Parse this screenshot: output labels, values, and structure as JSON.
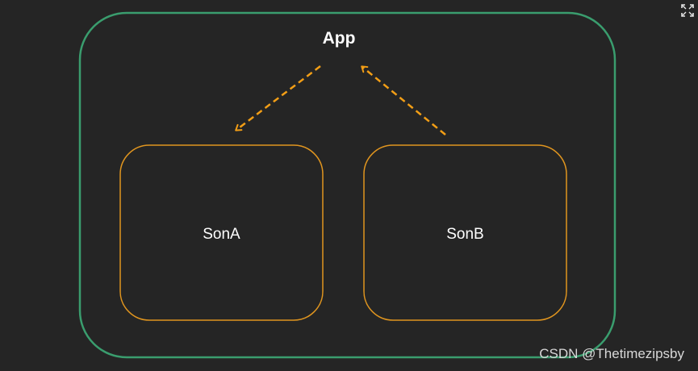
{
  "app": {
    "label": "App"
  },
  "children": [
    {
      "label": "SonA"
    },
    {
      "label": "SonB"
    }
  ],
  "watermark": "CSDN @Thetimezipsby",
  "icons": {
    "expand": "expand-icon"
  },
  "colors": {
    "background": "#252525",
    "app_border": "#3a9d6e",
    "child_border": "#e0951f",
    "arrow": "#f29e16",
    "text": "#ffffff"
  }
}
